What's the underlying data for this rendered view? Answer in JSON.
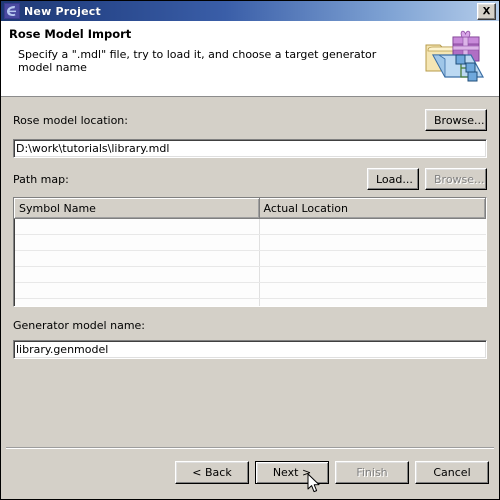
{
  "window": {
    "title": "New Project",
    "title_icon": "eclipse-project-icon",
    "close_label": "x"
  },
  "header": {
    "title": "Rose Model Import",
    "description": "Specify a \".mdl\" file, try to load it, and choose a target generator model name",
    "banner_icon": "new-project-folder-gift-icon"
  },
  "form": {
    "rose_model_label": "Rose model location:",
    "rose_model_value": "D:\\work\\tutorials\\library.mdl",
    "rose_model_placeholder": "",
    "browse_top_label": "Browse...",
    "path_map_label": "Path map:",
    "load_label": "Load...",
    "browse_pathmap_label": "Browse...",
    "generator_label": "Generator model name:",
    "generator_value": "library.genmodel",
    "generator_placeholder": ""
  },
  "table": {
    "columns": [
      "Symbol Name",
      "Actual Location"
    ],
    "rows": [
      [
        "",
        ""
      ],
      [
        "",
        ""
      ],
      [
        "",
        ""
      ],
      [
        "",
        ""
      ],
      [
        "",
        ""
      ],
      [
        "",
        ""
      ],
      [
        "",
        ""
      ]
    ]
  },
  "footer": {
    "back_label": "< Back",
    "next_label": "Next >",
    "finish_label": "Finish",
    "cancel_label": "Cancel"
  },
  "colors": {
    "title_bar_start": "#1f3a74",
    "title_bar_end": "#b5cdea",
    "dialog_bg": "#d4d0c8",
    "header_bg": "#ffffff",
    "field_bg": "#ffffff",
    "disabled_text": "#808080"
  }
}
